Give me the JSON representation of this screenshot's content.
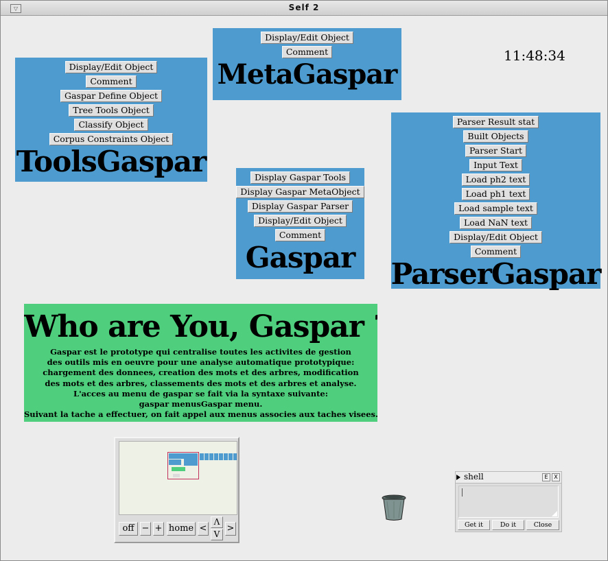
{
  "window": {
    "title": "Self 2",
    "menu_glyph": "▽"
  },
  "clock": "11:48:34",
  "metagaspar": {
    "buttons": [
      "Display/Edit Object",
      "Comment"
    ],
    "title": "MetaGaspar"
  },
  "toolsgaspar": {
    "buttons": [
      "Display/Edit Object",
      "Comment",
      "Gaspar Define Object",
      "Tree Tools Object",
      "Classify Object",
      "Corpus Constraints Object"
    ],
    "title": "ToolsGaspar"
  },
  "gaspar": {
    "buttons": [
      "Display Gaspar Tools",
      "Display Gaspar MetaObject",
      "Display Gaspar Parser",
      "Display/Edit Object",
      "Comment"
    ],
    "title": "Gaspar"
  },
  "parsergaspar": {
    "buttons": [
      "Parser Result stat",
      "Built Objects",
      "Parser Start",
      "Input Text",
      "Load ph2 text",
      "Load ph1 text",
      "Load sample text",
      "Load NaN text",
      "Display/Edit Object",
      "Comment"
    ],
    "title": "ParserGaspar"
  },
  "info": {
    "headline": "Who are You, Gaspar ?",
    "lines": [
      "Gaspar est le prototype qui centralise toutes les activites de gestion",
      "des outils mis en oeuvre pour une analyse automatique prototypique:",
      "chargement des donnees, creation des mots et des arbres, modification",
      "des mots et des arbres, classements des mots et des arbres et analyse.",
      "L'acces au menu de gaspar se fait via la syntaxe suivante:",
      "gaspar menusGaspar menu.",
      "Suivant la tache a effectuer, on fait appel aux menus associes aux taches visees."
    ]
  },
  "navigator": {
    "off": "off",
    "minus": "−",
    "plus": "+",
    "home": "home",
    "left": "<",
    "up": "Λ",
    "down": "V",
    "right": ">"
  },
  "shell": {
    "title": "shell",
    "e_label": "E",
    "x_label": "X",
    "get_it": "Get it",
    "do_it": "Do it",
    "close": "Close"
  },
  "colors": {
    "outliner_blue": "#4e9bd0",
    "info_green": "#4fcf7d",
    "desktop": "#ececec"
  },
  "icons": {
    "trash": "trash-can-icon"
  }
}
